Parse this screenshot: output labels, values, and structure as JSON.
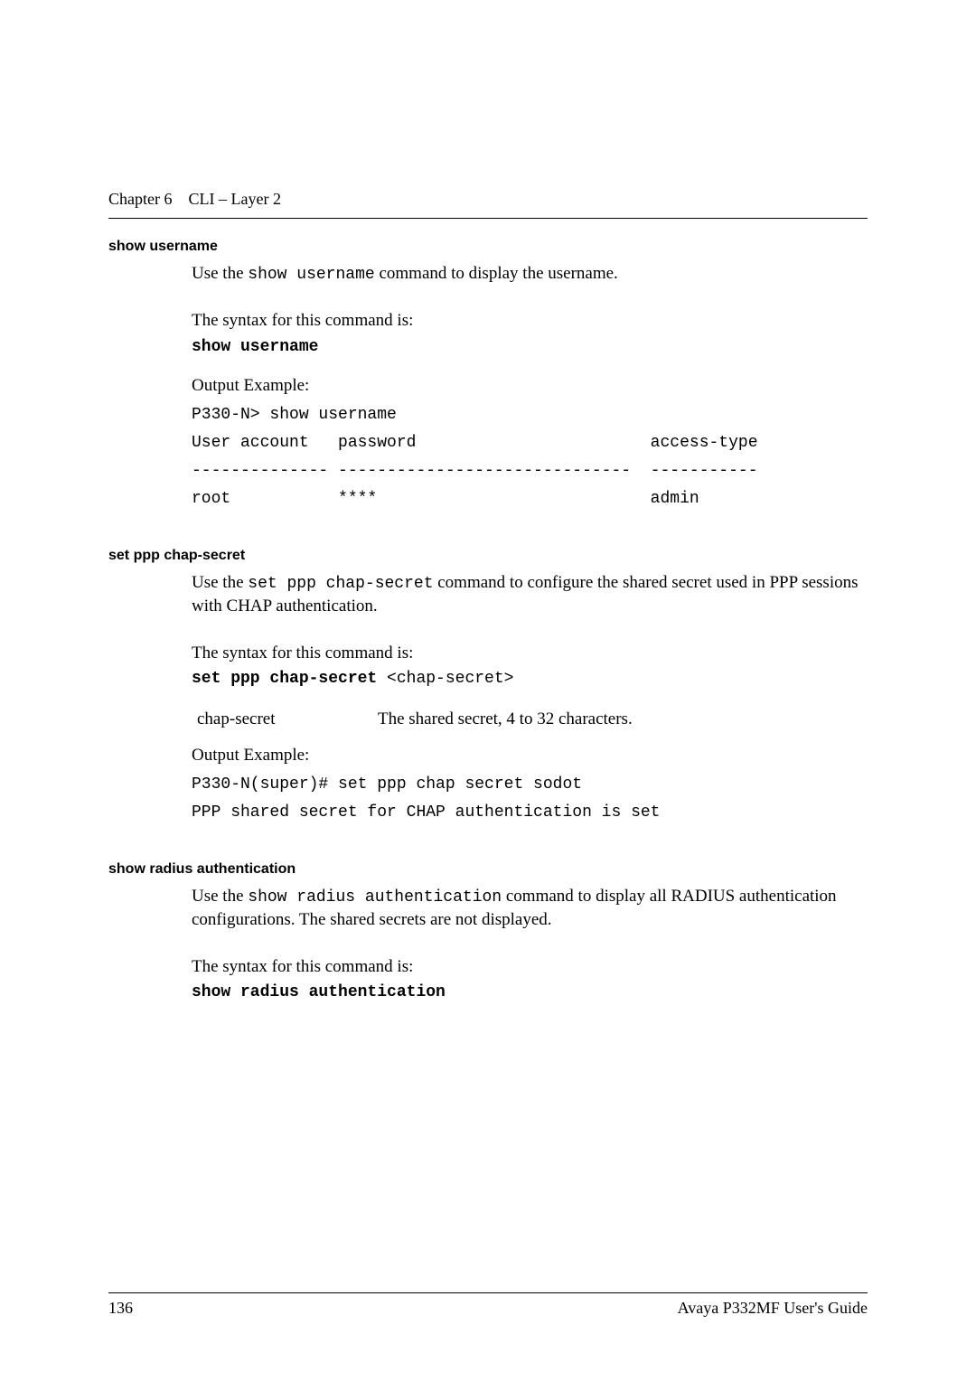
{
  "header": {
    "chapter_label": "Chapter 6",
    "chapter_title": "CLI – Layer 2"
  },
  "sections": {
    "show_username": {
      "heading": "show username",
      "desc_prefix": "Use the ",
      "desc_code": "show username",
      "desc_suffix": " command to display the username.",
      "syntax_intro": "The syntax for this command is:",
      "syntax_code": "show username",
      "output_label": "Output Example:",
      "output_lines": {
        "l1": "P330-N> show username",
        "l2": "User account   password                        access-type",
        "l3": "-------------- ------------------------------  -----------",
        "l4": "root           ****                            admin"
      }
    },
    "set_ppp": {
      "heading": "set ppp chap-secret",
      "desc_prefix": "Use the ",
      "desc_code": "set ppp chap-secret",
      "desc_suffix": " command to configure the shared secret used in PPP sessions with CHAP authentication.",
      "syntax_intro": "The syntax for this command is:",
      "syntax_code_bold": "set ppp chap-secret",
      "syntax_code_rest": " <chap-secret>",
      "param_name": "chap-secret",
      "param_desc": "The shared secret, 4 to 32 characters.",
      "output_label": "Output Example:",
      "output_lines": {
        "l1": "P330-N(super)# set ppp chap secret sodot",
        "l2": "PPP shared secret for CHAP authentication is set"
      }
    },
    "show_radius": {
      "heading": "show radius authentication",
      "desc_prefix": "Use the ",
      "desc_code": "show radius authentication",
      "desc_suffix": " command to display all RADIUS authentication configurations. The shared secrets are not displayed.",
      "syntax_intro": "The syntax for this command is:",
      "syntax_code": "show radius authentication"
    }
  },
  "footer": {
    "page_number": "136",
    "doc_title": "Avaya P332MF User's Guide"
  }
}
